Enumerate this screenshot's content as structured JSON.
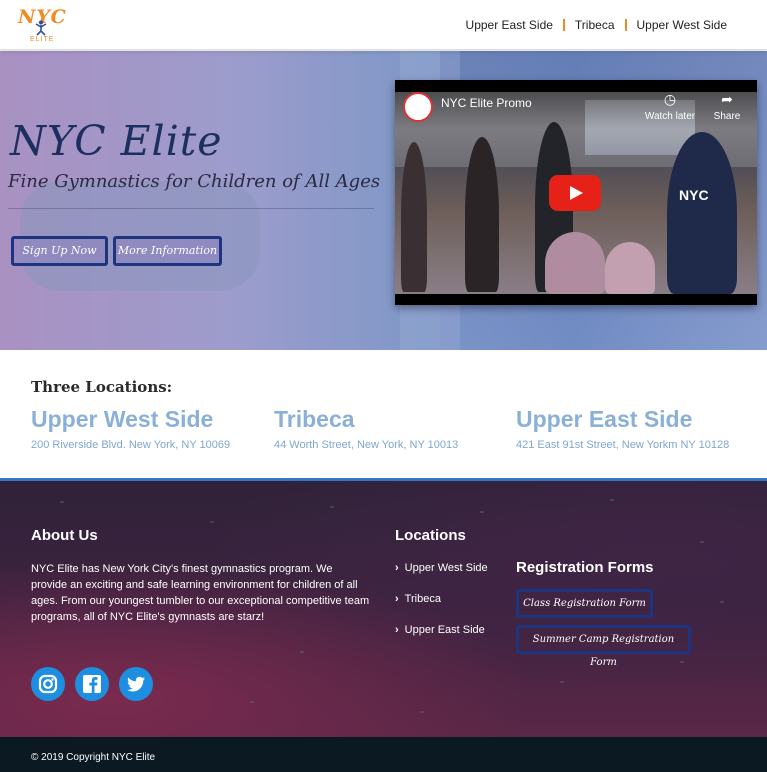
{
  "brand": {
    "logo_text": "NYC",
    "logo_sub": "ELITE"
  },
  "nav": {
    "links": [
      "Upper East Side",
      "Tribeca",
      "Upper West Side"
    ],
    "accent": "#f08a24"
  },
  "hero": {
    "title": "NYC Elite",
    "subtitle": "Fine Gymnastics for Children of All Ages",
    "buttons": {
      "signup": "Sign Up Now",
      "more": "More Information"
    }
  },
  "video": {
    "title": "NYC Elite Promo",
    "watch_later": "Watch later",
    "share": "Share",
    "shirt_text": "NYC"
  },
  "locations": {
    "heading": "Three Locations:",
    "items": [
      {
        "name": "Upper West Side",
        "address": "200 Riverside Blvd. New York, NY 10069"
      },
      {
        "name": "Tribeca",
        "address": "44 Worth Street, New York, NY 10013"
      },
      {
        "name": "Upper East Side",
        "address": "421 East 91st Street, New Yorkm NY 10128"
      }
    ]
  },
  "footer": {
    "about": {
      "heading": "About Us",
      "text": "NYC Elite has New York City's finest gymnastics program. We provide an exciting and safe learning environment for children of all ages. From our youngest tumbler to our exceptional competitive team programs, all of NYC Elite's gymnasts are starz!"
    },
    "locations": {
      "heading": "Locations",
      "items": [
        "Upper West Side",
        "Tribeca",
        "Upper East Side"
      ]
    },
    "registration": {
      "heading": "Registration Forms",
      "class_form": "Class Registration Form",
      "camp_form": "Summer Camp Registration Form"
    },
    "social": [
      "instagram-icon",
      "facebook-icon",
      "twitter-icon"
    ],
    "copyright": "© 2019 Copyright NYC Elite"
  },
  "colors": {
    "location_blue": "#8bb0d8",
    "button_border": "#1d3580",
    "social_blue": "#1e8fe0"
  }
}
